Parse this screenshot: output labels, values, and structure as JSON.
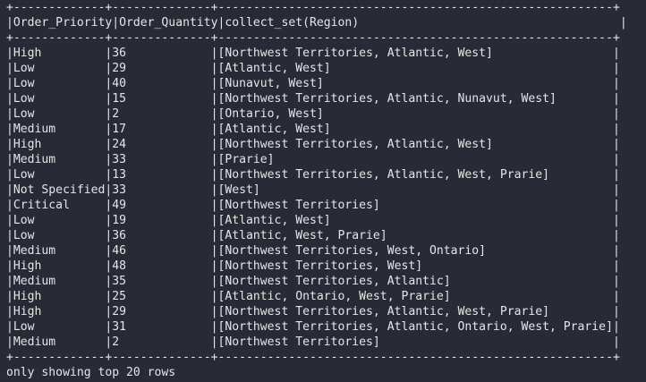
{
  "table": {
    "border_top": "+-------------+--------------+--------------------------------------------------------+",
    "header": "|Order_Priority|Order_Quantity|collect_set(Region)                                     |",
    "border_mid": "+-------------+--------------+--------------------------------------------------------+",
    "columns": [
      "Order_Priority",
      "Order_Quantity",
      "collect_set(Region)"
    ],
    "rows": [
      [
        "High",
        "36",
        "[Northwest Territories, Atlantic, West]"
      ],
      [
        "Low",
        "29",
        "[Atlantic, West]"
      ],
      [
        "Low",
        "40",
        "[Nunavut, West]"
      ],
      [
        "Low",
        "15",
        "[Northwest Territories, Atlantic, Nunavut, West]"
      ],
      [
        "Low",
        "2",
        "[Ontario, West]"
      ],
      [
        "Medium",
        "17",
        "[Atlantic, West]"
      ],
      [
        "High",
        "24",
        "[Northwest Territories, Atlantic, West]"
      ],
      [
        "Medium",
        "33",
        "[Prarie]"
      ],
      [
        "Low",
        "13",
        "[Northwest Territories, Atlantic, West, Prarie]"
      ],
      [
        "Not Specified",
        "33",
        "[West]"
      ],
      [
        "Critical",
        "49",
        "[Northwest Territories]"
      ],
      [
        "Low",
        "19",
        "[Atlantic, West]"
      ],
      [
        "Low",
        "36",
        "[Atlantic, West, Prarie]"
      ],
      [
        "Medium",
        "46",
        "[Northwest Territories, West, Ontario]"
      ],
      [
        "High",
        "48",
        "[Northwest Territories, West]"
      ],
      [
        "Medium",
        "35",
        "[Northwest Territories, Atlantic]"
      ],
      [
        "High",
        "25",
        "[Atlantic, Ontario, West, Prarie]"
      ],
      [
        "High",
        "29",
        "[Northwest Territories, Atlantic, West, Prarie]"
      ],
      [
        "Low",
        "31",
        "[Northwest Territories, Atlantic, Ontario, West, Prarie]"
      ],
      [
        "Medium",
        "2",
        "[Northwest Territories]"
      ]
    ],
    "border_bottom": "+-------------+--------------+--------------------------------------------------------+"
  },
  "footer": "only showing top 20 rows",
  "colors": {
    "background": "#282a36",
    "text": "#e6e6e6"
  }
}
